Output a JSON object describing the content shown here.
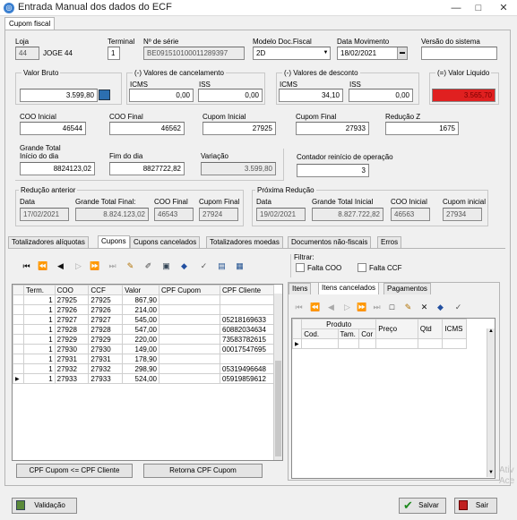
{
  "window": {
    "title": "Entrada Manual dos dados do ECF",
    "minimize": "—",
    "maximize": "□",
    "close": "✕"
  },
  "top_tab": "Cupom fiscal",
  "header": {
    "loja_label": "Loja",
    "loja_code": "44",
    "loja_name": "JOGE 44",
    "terminal_label": "Terminal",
    "terminal_value": "1",
    "serie_label": "Nº de série",
    "serie_value": "BE091510100011289397",
    "modelo_label": "Modelo Doc.Fiscal",
    "modelo_value": "2D",
    "data_mov_label": "Data Movimento",
    "data_mov_value": "18/02/2021",
    "versao_label": "Versão do sistema",
    "versao_value": ""
  },
  "valores": {
    "bruto_label": "Valor Bruto",
    "bruto_value": "3.599,80",
    "cancel_label": "(-) Valores de cancelamento",
    "cancel_icms_label": "ICMS",
    "cancel_icms": "0,00",
    "cancel_iss_label": "ISS",
    "cancel_iss": "0,00",
    "desc_label": "(-) Valores de desconto",
    "desc_icms_label": "ICMS",
    "desc_icms": "34,10",
    "desc_iss_label": "ISS",
    "desc_iss": "0,00",
    "liquido_label": "(=) Valor Liquido",
    "liquido_value": "3.565,70",
    "liquido_color": "#e02020"
  },
  "coo": {
    "coo_ini_label": "COO Inicial",
    "coo_ini": "46544",
    "coo_fim_label": "COO Final",
    "coo_fim": "46562",
    "cupom_ini_label": "Cupom Inicial",
    "cupom_ini": "27925",
    "cupom_fim_label": "Cupom Final",
    "cupom_fim": "27933",
    "reducao_label": "Redução Z",
    "reducao": "1675"
  },
  "grande_total": {
    "label": "Grande Total",
    "inicio_label": "Início do dia",
    "inicio": "8824123,02",
    "fim_label": "Fim do dia",
    "fim": "8827722,82",
    "variacao_label": "Variação",
    "variacao": "3.599,80",
    "contador_label": "Contador reinício de operação",
    "contador": "3"
  },
  "reducao_anterior": {
    "label": "Redução anterior",
    "data_label": "Data",
    "data": "17/02/2021",
    "gtf_label": "Grande Total Final:",
    "gtf": "8.824.123,02",
    "coo_label": "COO Final",
    "coo": "46543",
    "cupom_label": "Cupom Final",
    "cupom": "27924"
  },
  "proxima_reducao": {
    "label": "Próxima Redução",
    "data_label": "Data",
    "data": "19/02/2021",
    "gti_label": "Grande Total Inicial",
    "gti": "8.827.722,82",
    "coo_label": "COO Inicial",
    "coo": "46563",
    "cupom_label": "Cupom inicial",
    "cupom": "27934"
  },
  "tabs": [
    "Totalizadores alíquotas",
    "Cupons",
    "Cupons cancelados",
    "Totalizadores moedas",
    "Documentos não-fiscais",
    "Erros"
  ],
  "filtrar": {
    "label": "Filtrar:",
    "falta_coo": "Falta COO",
    "falta_ccf": "Falta CCF"
  },
  "cupons_table": {
    "headers": [
      "Term.",
      "COO",
      "CCF",
      "Valor",
      "CPF Cupom",
      "CPF Cliente"
    ],
    "rows": [
      [
        "1",
        "27925",
        "27925",
        "867,90",
        "",
        ""
      ],
      [
        "1",
        "27926",
        "27926",
        "214,00",
        "",
        ""
      ],
      [
        "1",
        "27927",
        "27927",
        "545,00",
        "",
        "05218169633"
      ],
      [
        "1",
        "27928",
        "27928",
        "547,00",
        "",
        "60882034634"
      ],
      [
        "1",
        "27929",
        "27929",
        "220,00",
        "",
        "73583782615"
      ],
      [
        "1",
        "27930",
        "27930",
        "149,00",
        "",
        "00017547695"
      ],
      [
        "1",
        "27931",
        "27931",
        "178,90",
        "",
        ""
      ],
      [
        "1",
        "27932",
        "27932",
        "298,90",
        "",
        "05319496648"
      ],
      [
        "1",
        "27933",
        "27933",
        "524,00",
        "",
        "05919859612"
      ]
    ]
  },
  "buttons": {
    "cpf_cupom": "CPF Cupom <= CPF Cliente",
    "retorna_cpf": "Retorna CPF Cupom",
    "validacao": "Validação",
    "salvar": "Salvar",
    "sair": "Sair"
  },
  "subtabs": [
    "Itens",
    "Itens cancelados",
    "Pagamentos"
  ],
  "itens_table": {
    "group_header": "Produto",
    "headers": [
      "Cod.",
      "Tam.",
      "Cor",
      "Preço",
      "Qtd",
      "ICMS"
    ]
  },
  "watermark": "Ativ Ace"
}
